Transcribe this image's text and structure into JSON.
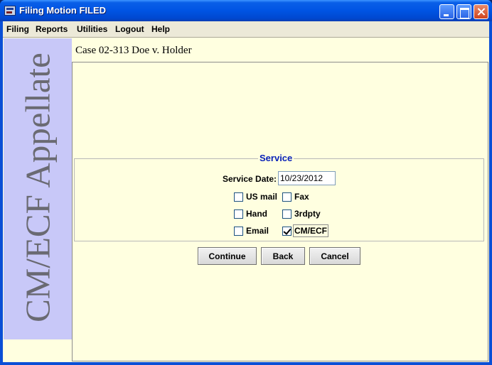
{
  "window": {
    "title": "Filing Motion FILED"
  },
  "menubar": {
    "items": [
      "Filing",
      "Reports",
      "Utilities",
      "Logout",
      "Help"
    ]
  },
  "banner": {
    "text": "CM/ECF Appellate"
  },
  "case": {
    "title": "Case 02-313 Doe v. Holder"
  },
  "service": {
    "legend": "Service",
    "date_label": "Service Date:",
    "date_value": "10/23/2012",
    "options": [
      {
        "label": "US mail",
        "checked": false
      },
      {
        "label": "Fax",
        "checked": false
      },
      {
        "label": "Hand",
        "checked": false
      },
      {
        "label": "3rdpty",
        "checked": false
      },
      {
        "label": "Email",
        "checked": false
      },
      {
        "label": "CM/ECF",
        "checked": true
      }
    ]
  },
  "buttons": {
    "continue": "Continue",
    "back": "Back",
    "cancel": "Cancel"
  }
}
